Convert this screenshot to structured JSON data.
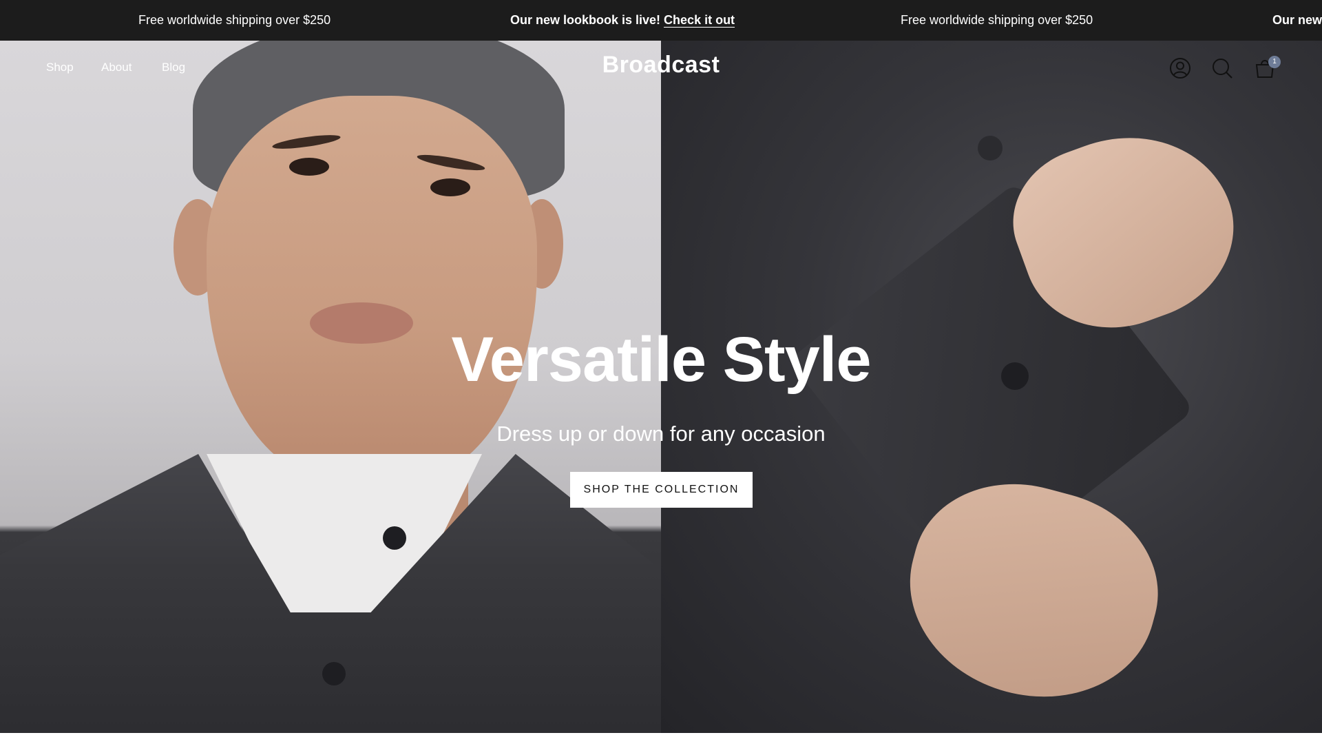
{
  "announcement_bar": {
    "messages": [
      {
        "text": "Free worldwide shipping over $250"
      },
      {
        "text": "Our new lookbook is live! ",
        "link": "Check it out"
      },
      {
        "text": "Free worldwide shipping over $250"
      },
      {
        "text": "Our new"
      }
    ],
    "background": "#1c1c1c"
  },
  "header": {
    "nav": [
      "Shop",
      "About",
      "Blog"
    ],
    "logo": "Broadcast",
    "icons": [
      "account-icon",
      "search-icon",
      "cart-icon"
    ],
    "cart_count": "1",
    "cart_badge_color": "#6f7d98"
  },
  "hero": {
    "title": "Versatile Style",
    "subtitle": "Dress up or down for any occasion",
    "cta_label": "SHOP THE COLLECTION"
  }
}
